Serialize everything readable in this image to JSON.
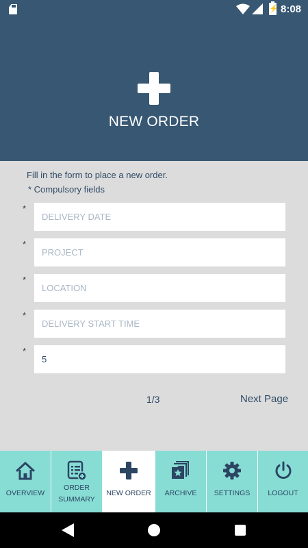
{
  "status_bar": {
    "time": "8:08",
    "icons": [
      "sd-card-icon",
      "wifi-icon",
      "signal-icon",
      "battery-charging-icon"
    ]
  },
  "header": {
    "icon": "plus-icon",
    "title": "NEW ORDER"
  },
  "form": {
    "intro": "Fill in the form to place a new order.",
    "required_note": "* Compulsory fields",
    "required_marker": "*",
    "fields": [
      {
        "placeholder": "DELIVERY DATE",
        "value": ""
      },
      {
        "placeholder": "PROJECT",
        "value": ""
      },
      {
        "placeholder": "LOCATION",
        "value": ""
      },
      {
        "placeholder": "DELIVERY START TIME",
        "value": ""
      },
      {
        "placeholder": "",
        "value": "5"
      }
    ],
    "page_indicator": "1/3",
    "next_label": "Next Page"
  },
  "tabs": [
    {
      "label": "OVERVIEW",
      "icon": "home-icon",
      "active": false
    },
    {
      "label_line1": "ORDER",
      "label_line2": "SUMMARY",
      "icon": "order-summary-icon",
      "active": false
    },
    {
      "label": "NEW ORDER",
      "icon": "plus-icon",
      "active": true
    },
    {
      "label": "ARCHIVE",
      "icon": "archive-icon",
      "active": false
    },
    {
      "label": "SETTINGS",
      "icon": "gear-icon",
      "active": false
    },
    {
      "label": "LOGOUT",
      "icon": "power-icon",
      "active": false
    }
  ],
  "colors": {
    "primary": "#375773",
    "text_dark": "#2f4a66",
    "tab_bar": "#87ddd4",
    "background": "#dcdcdc"
  }
}
